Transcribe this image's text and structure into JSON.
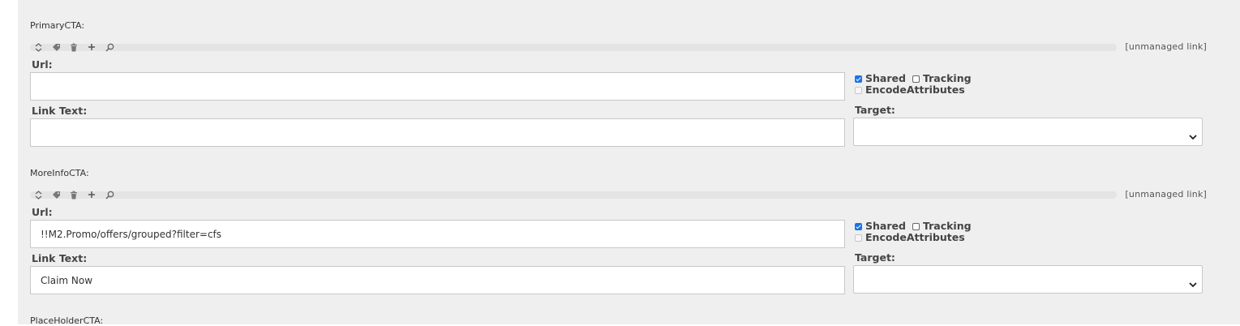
{
  "sections": [
    {
      "title": "PrimaryCTA:",
      "unmanaged": "[unmanaged link]",
      "url_label": "Url:",
      "url_value": "",
      "shared_label": "Shared",
      "shared_checked": true,
      "tracking_label": "Tracking",
      "tracking_checked": false,
      "encode_label": "EncodeAttributes",
      "encode_checked": false,
      "link_text_label": "Link Text:",
      "link_text_value": "",
      "target_label": "Target:",
      "target_value": ""
    },
    {
      "title": "MoreInfoCTA:",
      "unmanaged": "[unmanaged link]",
      "url_label": "Url:",
      "url_value": "!!M2.Promo/offers/grouped?filter=cfs",
      "shared_label": "Shared",
      "shared_checked": true,
      "tracking_label": "Tracking",
      "tracking_checked": false,
      "encode_label": "EncodeAttributes",
      "encode_checked": false,
      "link_text_label": "Link Text:",
      "link_text_value": "Claim Now",
      "target_label": "Target:",
      "target_value": ""
    },
    {
      "title": "PlaceHolderCTA:"
    }
  ],
  "toolbar_icons": [
    "sort-arrows-icon",
    "tag-icon",
    "trash-icon",
    "plus-icon",
    "search-icon"
  ],
  "colors": {
    "panel": "#efefef",
    "checkbox_checked": "#1a73e8",
    "input_border": "#c8c8c8"
  }
}
